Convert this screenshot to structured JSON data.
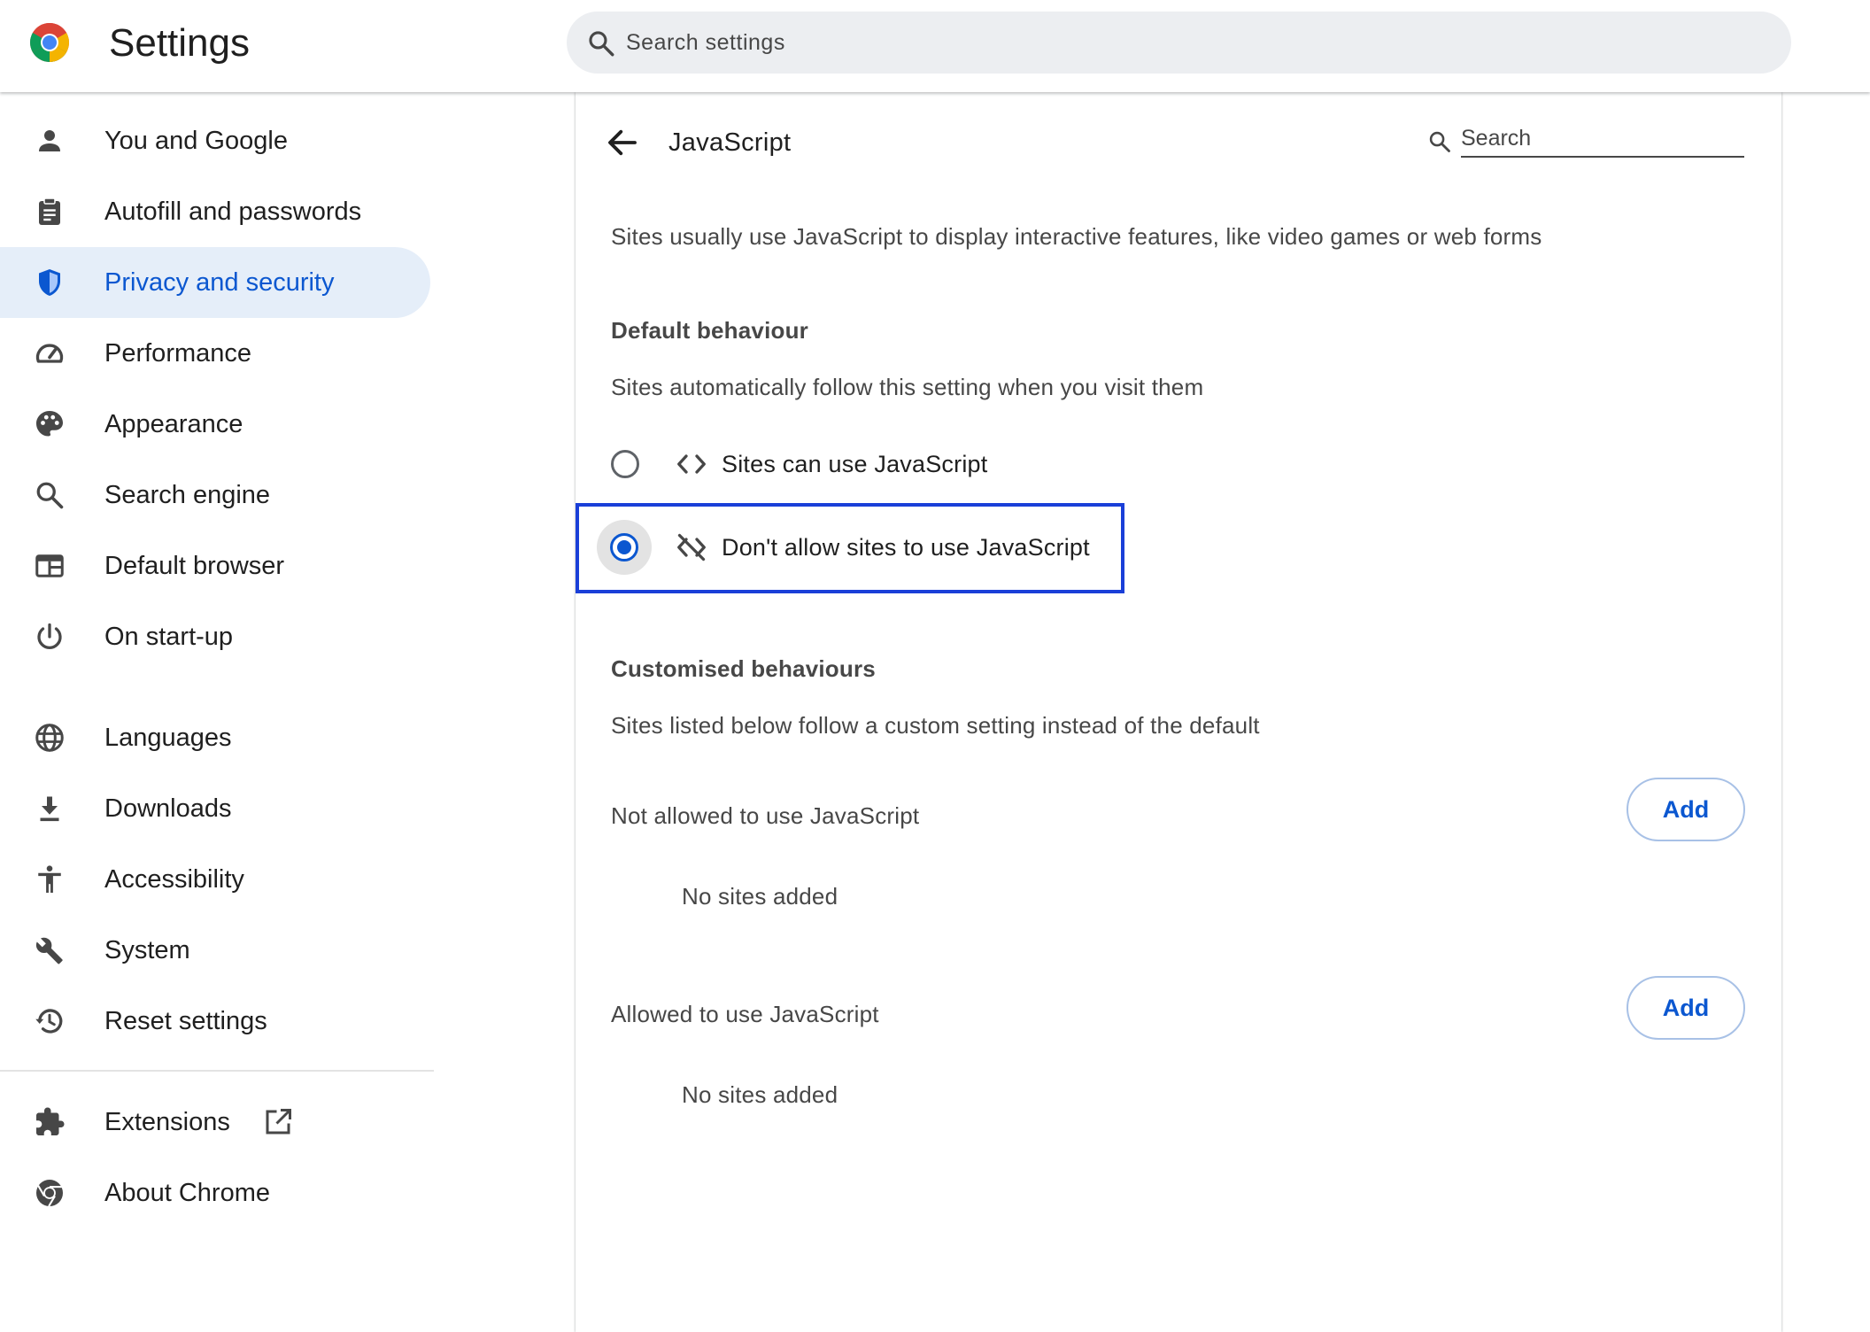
{
  "header": {
    "title": "Settings",
    "search_placeholder": "Search settings"
  },
  "sidebar": {
    "items": [
      {
        "label": "You and Google",
        "icon": "person-icon"
      },
      {
        "label": "Autofill and passwords",
        "icon": "clipboard-icon"
      },
      {
        "label": "Privacy and security",
        "icon": "shield-icon",
        "active": true
      },
      {
        "label": "Performance",
        "icon": "speedometer-icon"
      },
      {
        "label": "Appearance",
        "icon": "palette-icon"
      },
      {
        "label": "Search engine",
        "icon": "search-icon"
      },
      {
        "label": "Default browser",
        "icon": "browser-window-icon"
      },
      {
        "label": "On start-up",
        "icon": "power-icon"
      },
      {
        "label": "Languages",
        "icon": "globe-icon"
      },
      {
        "label": "Downloads",
        "icon": "download-icon"
      },
      {
        "label": "Accessibility",
        "icon": "accessibility-icon"
      },
      {
        "label": "System",
        "icon": "wrench-icon"
      },
      {
        "label": "Reset settings",
        "icon": "restore-icon"
      },
      {
        "label": "Extensions",
        "icon": "puzzle-icon"
      },
      {
        "label": "About Chrome",
        "icon": "chrome-icon"
      }
    ]
  },
  "main": {
    "title": "JavaScript",
    "search_placeholder": "Search",
    "description": "Sites usually use JavaScript to display interactive features, like video games or web forms",
    "default_heading": "Default behaviour",
    "default_subtext": "Sites automatically follow this setting when you visit them",
    "options": [
      {
        "label": "Sites can use JavaScript",
        "icon": "code-icon",
        "checked": false
      },
      {
        "label": "Don't allow sites to use JavaScript",
        "icon": "code-off-icon",
        "checked": true
      }
    ],
    "custom_heading": "Customised behaviours",
    "custom_subtext": "Sites listed below follow a custom setting instead of the default",
    "lists": [
      {
        "label": "Not allowed to use JavaScript",
        "button": "Add",
        "empty": "No sites added"
      },
      {
        "label": "Allowed to use JavaScript",
        "button": "Add",
        "empty": "No sites added"
      }
    ]
  },
  "colors": {
    "accent": "#0b57d0",
    "active_nav_bg": "#e5eef9",
    "highlight_border": "#1a3fd8",
    "icon_gray": "#474747"
  }
}
